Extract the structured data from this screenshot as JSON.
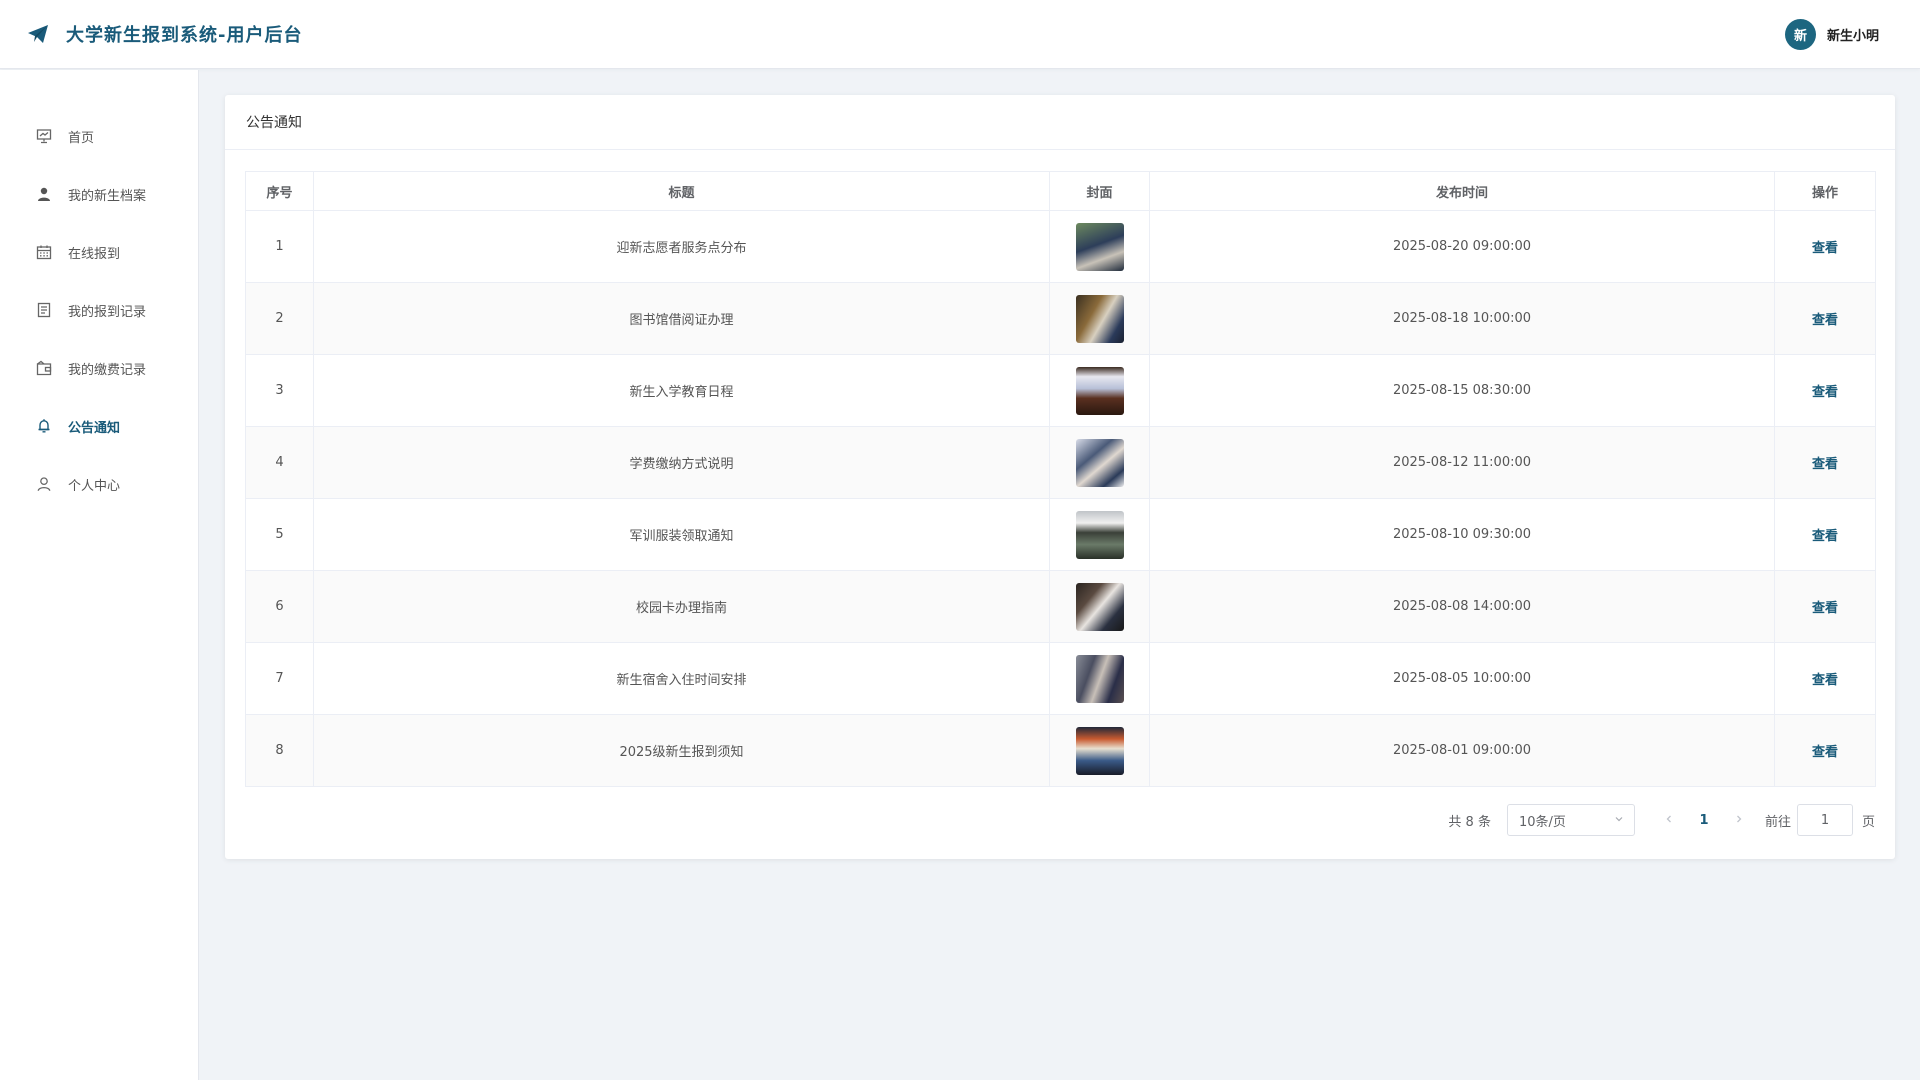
{
  "header": {
    "title": "大学新生报到系统-用户后台",
    "avatar_text": "新",
    "username": "新生小明"
  },
  "sidebar": {
    "items": [
      {
        "label": "首页",
        "icon": "presentation-icon",
        "active": false
      },
      {
        "label": "我的新生档案",
        "icon": "user-icon",
        "active": false
      },
      {
        "label": "在线报到",
        "icon": "calendar-icon",
        "active": false
      },
      {
        "label": "我的报到记录",
        "icon": "document-icon",
        "active": false
      },
      {
        "label": "我的缴费记录",
        "icon": "wallet-icon",
        "active": false
      },
      {
        "label": "公告通知",
        "icon": "bell-icon",
        "active": true
      },
      {
        "label": "个人中心",
        "icon": "person-icon",
        "active": false
      }
    ]
  },
  "main": {
    "card_title": "公告通知",
    "columns": [
      "序号",
      "标题",
      "封面",
      "发布时间",
      "操作"
    ],
    "rows": [
      {
        "index": "1",
        "title": "迎新志愿者服务点分布",
        "cover": "volunteer-photo",
        "time": "2025-08-20 09:00:00",
        "action": "查看"
      },
      {
        "index": "2",
        "title": "图书馆借阅证办理",
        "cover": "library-photo",
        "time": "2025-08-18 10:00:00",
        "action": "查看"
      },
      {
        "index": "3",
        "title": "新生入学教育日程",
        "cover": "lecture-photo",
        "time": "2025-08-15 08:30:00",
        "action": "查看"
      },
      {
        "index": "4",
        "title": "学费缴纳方式说明",
        "cover": "payment-photo",
        "time": "2025-08-12 11:00:00",
        "action": "查看"
      },
      {
        "index": "5",
        "title": "军训服装领取通知",
        "cover": "uniform-photo",
        "time": "2025-08-10 09:30:00",
        "action": "查看"
      },
      {
        "index": "6",
        "title": "校园卡办理指南",
        "cover": "campus-card-photo",
        "time": "2025-08-08 14:00:00",
        "action": "查看"
      },
      {
        "index": "7",
        "title": "新生宿舍入住时间安排",
        "cover": "dormitory-photo",
        "time": "2025-08-05 10:00:00",
        "action": "查看"
      },
      {
        "index": "8",
        "title": "2025级新生报到须知",
        "cover": "registration-photo",
        "time": "2025-08-01 09:00:00",
        "action": "查看"
      }
    ],
    "pagination": {
      "total": "共 8 条",
      "page_size": "10条/页",
      "current_page": "1",
      "goto_label": "前往",
      "goto_value": "1",
      "goto_suffix": "页"
    }
  },
  "colors": {
    "accent": "#1a5b7a",
    "background": "#f0f3f7"
  }
}
